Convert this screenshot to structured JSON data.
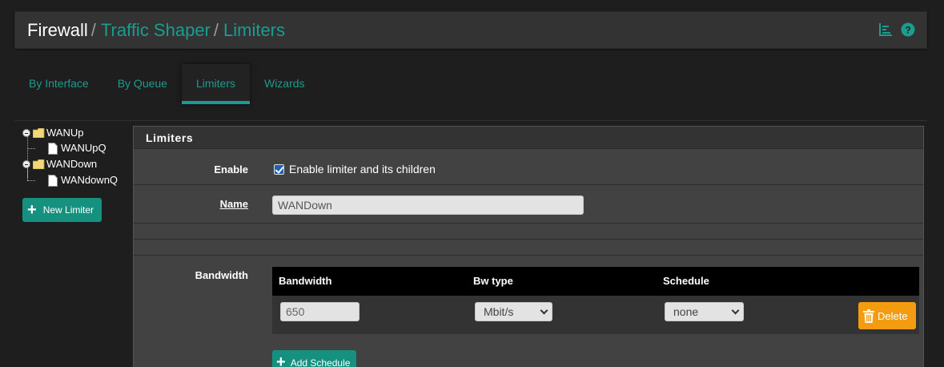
{
  "breadcrumb": {
    "root": "Firewall",
    "separator": "/",
    "items": [
      "Traffic Shaper",
      "Limiters"
    ]
  },
  "header_icons": [
    "chart-icon",
    "help-icon"
  ],
  "tabs": [
    {
      "label": "By Interface",
      "active": false
    },
    {
      "label": "By Queue",
      "active": false
    },
    {
      "label": "Limiters",
      "active": true
    },
    {
      "label": "Wizards",
      "active": false
    }
  ],
  "tree": {
    "limiters": [
      {
        "name": "WANUp",
        "queues": [
          "WANUpQ"
        ]
      },
      {
        "name": "WANDown",
        "queues": [
          "WANdownQ"
        ]
      }
    ]
  },
  "new_limiter_label": "New Limiter",
  "panel": {
    "title": "Limiters",
    "enable": {
      "label": "Enable",
      "checkbox_label": "Enable limiter and its children",
      "checked": true
    },
    "name": {
      "label": "Name",
      "value": "WANDown"
    },
    "bandwidth": {
      "label": "Bandwidth",
      "columns": [
        "Bandwidth",
        "Bw type",
        "Schedule"
      ],
      "rows": [
        {
          "bandwidth": "650",
          "bw_type": "Mbit/s",
          "schedule": "none"
        }
      ],
      "delete_label": "Delete"
    },
    "add_schedule_label": "Add Schedule"
  },
  "colors": {
    "accent": "#1a9d8f",
    "button_primary": "#16907f",
    "button_warning": "#f39c12",
    "background": "#1e1e1e"
  }
}
